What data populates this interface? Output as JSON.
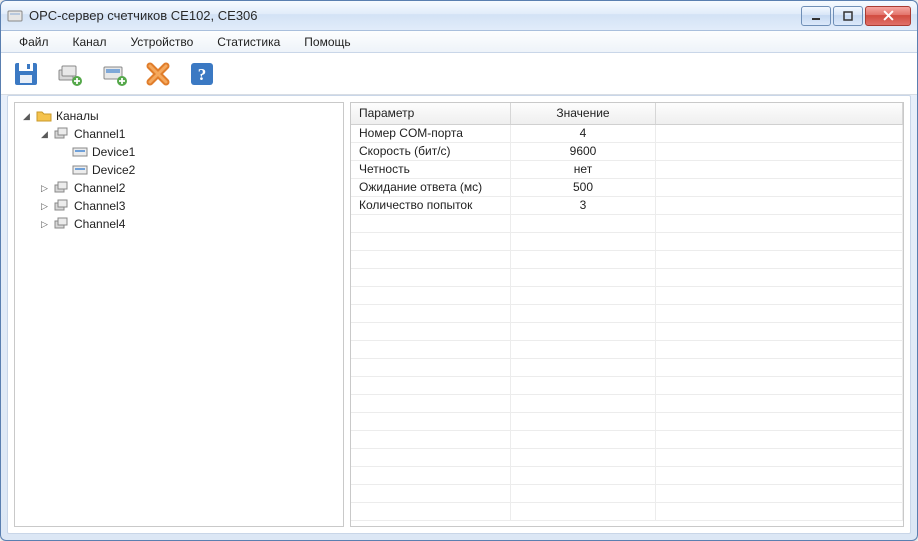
{
  "window": {
    "title": "OPC-сервер счетчиков CE102, CE306"
  },
  "menu": {
    "items": [
      "Файл",
      "Канал",
      "Устройство",
      "Статистика",
      "Помощь"
    ]
  },
  "toolbar": {
    "icons": [
      "save-icon",
      "add-channel-icon",
      "add-device-icon",
      "delete-icon",
      "help-icon"
    ]
  },
  "tree": {
    "root": {
      "label": "Каналы",
      "expanded": true,
      "children": [
        {
          "label": "Channel1",
          "expanded": true,
          "children": [
            {
              "label": "Device1"
            },
            {
              "label": "Device2"
            }
          ]
        },
        {
          "label": "Channel2"
        },
        {
          "label": "Channel3"
        },
        {
          "label": "Channel4"
        }
      ]
    }
  },
  "grid": {
    "headers": {
      "param": "Параметр",
      "value": "Значение"
    },
    "rows": [
      {
        "param": "Номер COM-порта",
        "value": "4"
      },
      {
        "param": "Скорость (бит/с)",
        "value": "9600"
      },
      {
        "param": "Четность",
        "value": "нет"
      },
      {
        "param": "Ожидание ответа (мс)",
        "value": "500"
      },
      {
        "param": "Количество попыток",
        "value": "3"
      }
    ],
    "empty_rows": 17
  },
  "colors": {
    "accent": "#3b79c3",
    "close": "#d14b3f",
    "delete": "#e07d2b",
    "help_bg": "#3b79c3"
  }
}
